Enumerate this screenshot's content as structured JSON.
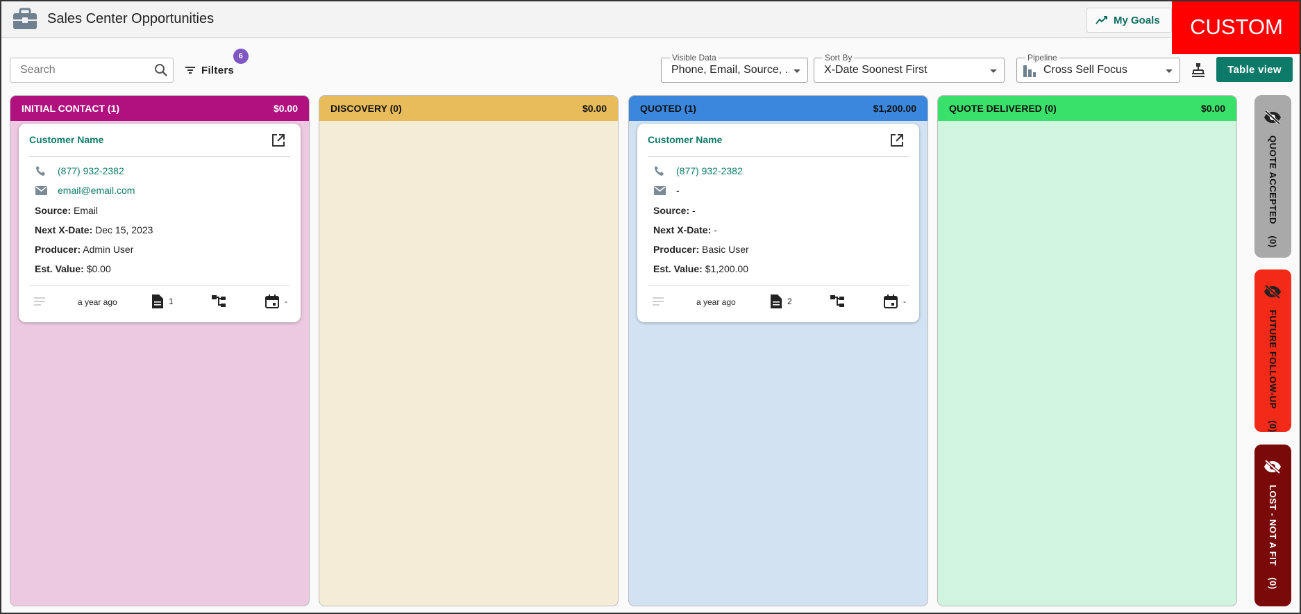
{
  "header": {
    "title": "Sales Center Opportunities",
    "goals_label": "My Goals",
    "badge": "CUSTOM"
  },
  "toolbar": {
    "search_placeholder": "Search",
    "filters_label": "Filters",
    "filters_count": "6",
    "visible_data": {
      "label": "Visible Data",
      "value": "Phone, Email, Source, ..."
    },
    "sort_by": {
      "label": "Sort By",
      "value": "X-Date Soonest First"
    },
    "pipeline": {
      "label": "Pipeline",
      "value": "Cross Sell Focus"
    },
    "table_view_label": "Table view"
  },
  "columns": [
    {
      "title": "INITIAL CONTACT (1)",
      "amount": "$0.00",
      "header_color": "#b0117f",
      "body_color": "#ecc9e0",
      "header_text_color": "#ffffff"
    },
    {
      "title": "DISCOVERY (0)",
      "amount": "$0.00",
      "header_color": "#e8bc5b",
      "body_color": "#f5ecd8",
      "header_text_color": "#111111"
    },
    {
      "title": "QUOTED (1)",
      "amount": "$1,200.00",
      "header_color": "#3a87dd",
      "body_color": "#d2e2f2",
      "header_text_color": "#111111"
    },
    {
      "title": "QUOTE DELIVERED (0)",
      "amount": "$0.00",
      "header_color": "#39e16b",
      "body_color": "#d1f4de",
      "header_text_color": "#111111"
    }
  ],
  "cards": [
    {
      "name": "Customer Name",
      "phone": "(877) 932-2382",
      "email": "email@email.com",
      "source_label": "Source:",
      "source": "Email",
      "xdate_label": "Next X-Date:",
      "xdate": "Dec 15, 2023",
      "producer_label": "Producer:",
      "producer": "Admin User",
      "value_label": "Est. Value:",
      "value": "$0.00",
      "age": "a year ago",
      "docs": "1",
      "date": "-"
    },
    {
      "name": "Customer Name",
      "phone": "(877) 932-2382",
      "email": "-",
      "source_label": "Source:",
      "source": "-",
      "xdate_label": "Next X-Date:",
      "xdate": "-",
      "producer_label": "Producer:",
      "producer": "Basic User",
      "value_label": "Est. Value:",
      "value": "$1,200.00",
      "age": "a year ago",
      "docs": "2",
      "date": "-"
    }
  ],
  "side_tabs": [
    {
      "label": "QUOTE ACCEPTED",
      "count": "(0)",
      "color": "#a9a9a9",
      "text_color": "#111111"
    },
    {
      "label": "FUTURE FOLLOW-UP",
      "count": "(0)",
      "color": "#f42a18",
      "text_color": "#111111"
    },
    {
      "label": "LOST - NOT A FIT",
      "count": "(0)",
      "color": "#7a0a0a",
      "text_color": "#ffffff"
    }
  ]
}
